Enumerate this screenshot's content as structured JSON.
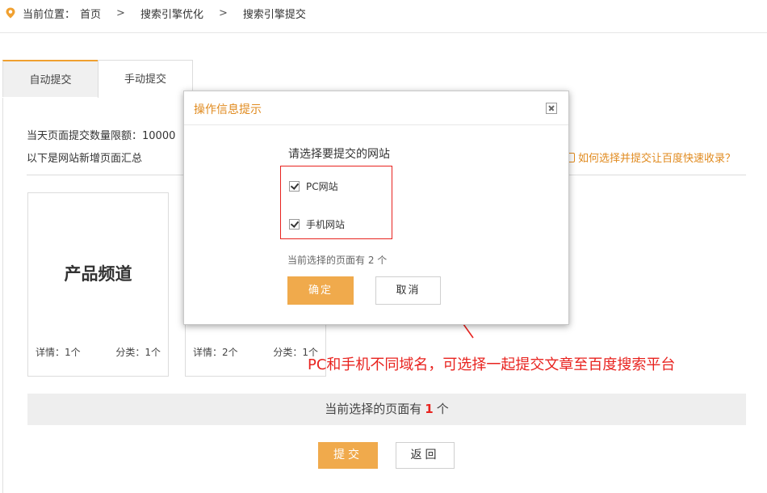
{
  "breadcrumb": {
    "prefix": "当前位置：",
    "items": [
      "首页",
      "搜索引擎优化",
      "搜索引擎提交"
    ],
    "separator": ">"
  },
  "tabs": [
    {
      "label": "自动提交",
      "active": true
    },
    {
      "label": "手动提交",
      "active": false
    }
  ],
  "panel": {
    "limit_text": "当天页面提交数量限额：10000",
    "summary_text": "以下是网站新增页面汇总",
    "help_link": "如何选择并提交让百度快速收录？"
  },
  "cards": [
    {
      "title": "产品频道",
      "detail": "详情：1个",
      "category": "分类：1个"
    },
    {
      "title": "",
      "detail": "详情：2个",
      "category": "分类：1个"
    }
  ],
  "annotation": "PC和手机不同域名，可选择一起提交文章至百度搜索平台",
  "selection_bar": {
    "prefix": "当前选择的页面有",
    "count": "1",
    "suffix": "个"
  },
  "buttons": {
    "submit": "提交",
    "back": "返回"
  },
  "modal": {
    "title": "操作信息提示",
    "prompt": "请选择要提交的网站",
    "options": [
      {
        "label": "PC网站",
        "checked": true
      },
      {
        "label": "手机网站",
        "checked": true
      }
    ],
    "count_text": "当前选择的页面有 2 个",
    "confirm": "确定",
    "cancel": "取消"
  },
  "colors": {
    "accent": "#f0aa4c",
    "annotation_red": "#e8231f",
    "link_orange": "#e08a1e"
  }
}
